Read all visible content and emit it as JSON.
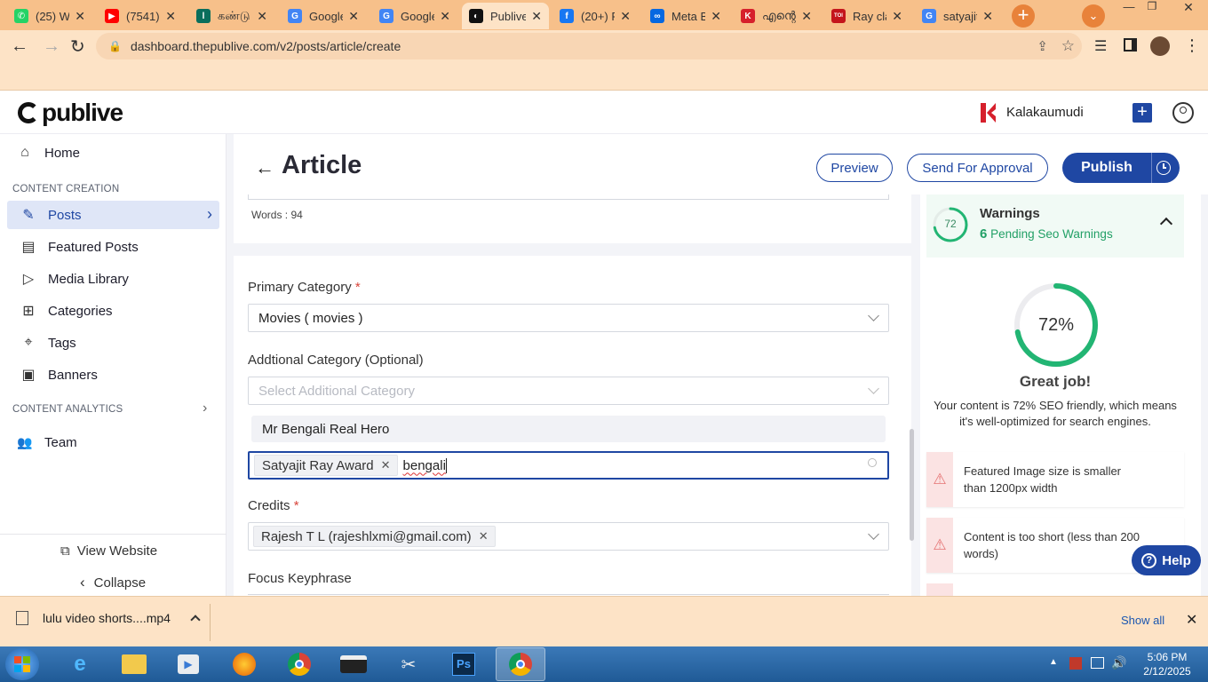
{
  "browser": {
    "tabs": [
      {
        "label": "(25) W",
        "icon": "whatsapp-icon",
        "color": "#25d366",
        "glyph": "✆"
      },
      {
        "label": "(7541)",
        "icon": "youtube-icon",
        "color": "#ff0000",
        "glyph": "▶"
      },
      {
        "label": "கண்டு",
        "icon": "site-icon",
        "color": "#0a6e5c",
        "glyph": "l"
      },
      {
        "label": "Google",
        "icon": "google-translate-icon",
        "color": "#4285f4",
        "glyph": "G"
      },
      {
        "label": "Google",
        "icon": "google-icon",
        "color": "#4285f4",
        "glyph": "G"
      },
      {
        "label": "Publive",
        "icon": "publive-icon",
        "color": "#111111",
        "glyph": "◐"
      },
      {
        "label": "(20+) F",
        "icon": "facebook-icon",
        "color": "#1877f2",
        "glyph": "f"
      },
      {
        "label": "Meta B",
        "icon": "meta-icon",
        "color": "#0668e1",
        "glyph": "∞"
      },
      {
        "label": "എന്റെ",
        "icon": "kalakaumudi-icon",
        "color": "#d6202c",
        "glyph": "K"
      },
      {
        "label": "Ray cla",
        "icon": "toi-icon",
        "color": "#c4151c",
        "glyph": "TOI"
      },
      {
        "label": "satyajit",
        "icon": "google-icon",
        "color": "#4285f4",
        "glyph": "G"
      }
    ],
    "url": "dashboard.thepublive.com/v2/posts/article/create"
  },
  "app": {
    "logo": "publive",
    "publisher": "Kalakaumudi",
    "sidebar": {
      "home": "Home",
      "section_creation": "CONTENT CREATION",
      "items": [
        {
          "label": "Posts",
          "icon": "edit-icon"
        },
        {
          "label": "Featured Posts",
          "icon": "featured-icon"
        },
        {
          "label": "Media Library",
          "icon": "media-icon"
        },
        {
          "label": "Categories",
          "icon": "categories-icon"
        },
        {
          "label": "Tags",
          "icon": "tag-icon"
        },
        {
          "label": "Banners",
          "icon": "banner-icon"
        }
      ],
      "section_analytics": "CONTENT ANALYTICS",
      "team": "Team",
      "view_website": "View Website",
      "collapse": "Collapse"
    },
    "header": {
      "title": "Article",
      "preview": "Preview",
      "send_for_approval": "Send For Approval",
      "publish": "Publish"
    },
    "form": {
      "words": "Words : 94",
      "primary_category_label": "Primary Category",
      "primary_category_value": "Movies ( movies )",
      "additional_category_label": "Addtional Category (Optional)",
      "additional_category_placeholder": "Select Additional Category",
      "dropdown_option": "Mr Bengali Real Hero",
      "tags_chip": "Satyajit Ray Award",
      "tags_input": "bengali",
      "credits_label": "Credits",
      "credits_chip": "Rajesh T L (rajeshlxmi@gmail.com)",
      "focus_keyphrase_label": "Focus Keyphrase"
    },
    "seo": {
      "score": "72",
      "warnings_title": "Warnings",
      "pending_count": "6",
      "pending_text": "Pending Seo Warnings",
      "score_percent": "72%",
      "score_fraction": 0.72,
      "great_job": "Great job!",
      "description": "Your content is 72% SEO friendly, which means it's well-optimized for search engines.",
      "warnings": [
        "Featured Image size is smaller than 1200px width",
        "Content is too short (less than 200 words)"
      ]
    },
    "help": "Help"
  },
  "downloads": {
    "file": "lulu video shorts....mp4",
    "show_all": "Show all"
  },
  "taskbar": {
    "time": "5:06 PM",
    "date": "2/12/2025"
  },
  "colors": {
    "brand_blue": "#1f47a3",
    "seo_green": "#22b573",
    "warning_red": "#e57373"
  }
}
